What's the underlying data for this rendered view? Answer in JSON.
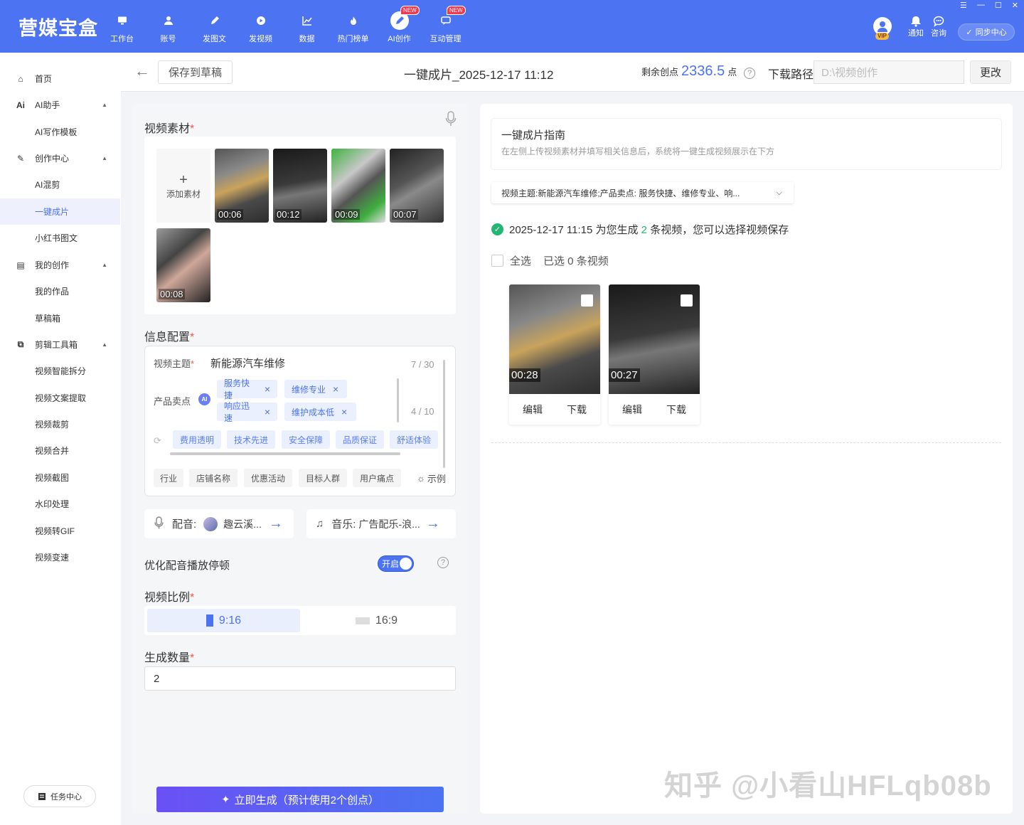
{
  "app": {
    "brand": "营媒宝盒"
  },
  "nav": [
    {
      "label": "工作台",
      "icon": "monitor-icon"
    },
    {
      "label": "账号",
      "icon": "user-icon"
    },
    {
      "label": "发图文",
      "icon": "pen-icon"
    },
    {
      "label": "发视频",
      "icon": "play-icon"
    },
    {
      "label": "数据",
      "icon": "chart-icon"
    },
    {
      "label": "热门榜单",
      "icon": "fire-icon"
    },
    {
      "label": "AI创作",
      "icon": "ai-pen-icon",
      "badge": "NEW",
      "active": true
    },
    {
      "label": "互动管理",
      "icon": "chat-icon",
      "badge": "NEW"
    }
  ],
  "topright": {
    "vip": "VIP",
    "notify": "通知",
    "consult": "咨询",
    "sync": "同步中心"
  },
  "sidebar": {
    "items": [
      {
        "label": "首页",
        "type": "parent",
        "icon": "home-icon"
      },
      {
        "label": "AI助手",
        "type": "parent",
        "icon": "ai-icon",
        "glyph": "Ai",
        "caret": true
      },
      {
        "label": "AI写作模板",
        "type": "child"
      },
      {
        "label": "创作中心",
        "type": "parent",
        "icon": "edit-icon",
        "caret": true
      },
      {
        "label": "AI混剪",
        "type": "child"
      },
      {
        "label": "一键成片",
        "type": "child",
        "active": true
      },
      {
        "label": "小红书图文",
        "type": "child"
      },
      {
        "label": "我的创作",
        "type": "parent",
        "icon": "doc-icon",
        "caret": true
      },
      {
        "label": "我的作品",
        "type": "child"
      },
      {
        "label": "草稿箱",
        "type": "child"
      },
      {
        "label": "剪辑工具箱",
        "type": "parent",
        "icon": "crop-icon",
        "caret": true
      },
      {
        "label": "视频智能拆分",
        "type": "child"
      },
      {
        "label": "视频文案提取",
        "type": "child"
      },
      {
        "label": "视频裁剪",
        "type": "child"
      },
      {
        "label": "视频合并",
        "type": "child"
      },
      {
        "label": "视频截图",
        "type": "child"
      },
      {
        "label": "水印处理",
        "type": "child"
      },
      {
        "label": "视频转GIF",
        "type": "child"
      },
      {
        "label": "视频变速",
        "type": "child"
      }
    ],
    "task_center": "任务中心"
  },
  "header": {
    "save_draft": "保存到草稿",
    "title": "一键成片_2025-12-17 11:12",
    "credits_label": "剩余创点",
    "credits_value": "2336.5",
    "credits_unit": "点",
    "download_label": "下载路径",
    "download_placeholder": "D:\\视频创作",
    "change": "更改"
  },
  "left": {
    "material_title": "视频素材",
    "add_material": "添加素材",
    "materials": [
      {
        "dur": "00:06",
        "theme": "lathe"
      },
      {
        "dur": "00:12",
        "theme": "underbody"
      },
      {
        "dur": "00:09",
        "theme": "green-machine"
      },
      {
        "dur": "00:07",
        "theme": "engine"
      },
      {
        "dur": "00:08",
        "theme": "hands"
      }
    ],
    "info_title": "信息配置",
    "topic_label": "视频主题",
    "topic_value": "新能源汽车维修",
    "topic_count": "7 / 30",
    "selling_label": "产品卖点",
    "selling_count": "4 / 10",
    "selling_tags": [
      "服务快捷",
      "维修专业",
      "响应迅速",
      "维护成本低"
    ],
    "suggest_chips": [
      "费用透明",
      "技术先进",
      "安全保障",
      "品质保证",
      "舒适体验"
    ],
    "category_chips": [
      "行业",
      "店铺名称",
      "优惠活动",
      "目标人群",
      "用户痛点"
    ],
    "example": "示例",
    "voice_label": "配音:",
    "voice_value": "趣云溪...",
    "music_label": "音乐:",
    "music_value": "广告配乐-浪...",
    "optimize_label": "优化配音播放停顿",
    "toggle_text": "开启",
    "ratio_title": "视频比例",
    "ratio_916": "9:16",
    "ratio_169": "16:9",
    "count_title": "生成数量",
    "count_value": "2",
    "generate": "立即生成（预计使用2个创点）"
  },
  "right": {
    "guide_title": "一键成片指南",
    "guide_desc": "在左侧上传视频素材并填写相关信息后，系统将一键生成视频展示在下方",
    "topic_select": "视频主题:新能源汽车维修;产品卖点: 服务快捷、维修专业、响...",
    "gen_prefix": "2025-12-17 11:15 为您生成",
    "gen_count": "2",
    "gen_suffix": "条视频，您可以选择视频保存",
    "select_all": "全选",
    "selected": "已选 0 条视频",
    "videos": [
      {
        "dur": "00:28",
        "edit": "编辑",
        "download": "下载"
      },
      {
        "dur": "00:27",
        "edit": "编辑",
        "download": "下载"
      }
    ]
  },
  "watermark": "知乎 @小看山HFLqb08b",
  "colors": {
    "accent": "#4b73f2",
    "success": "#22b573",
    "required": "#f54",
    "new_badge": "#f2394e"
  }
}
